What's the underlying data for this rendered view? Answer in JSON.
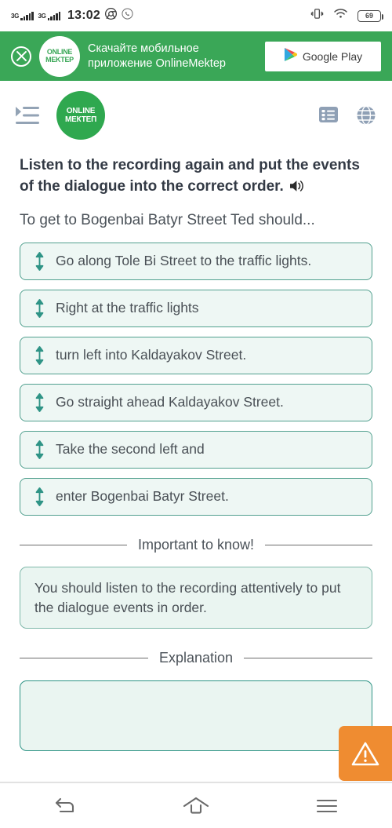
{
  "status_bar": {
    "network_label_1": "3G",
    "network_label_2": "3G",
    "time": "13:02",
    "chrome_icon": "chrome-icon",
    "whatsapp_icon": "whatsapp-icon",
    "vibrate_icon": "vibrate-icon",
    "wifi_icon": "wifi-icon",
    "battery_level": "69"
  },
  "promo_banner": {
    "close_icon": "close-icon",
    "logo_line1": "ONLINE",
    "logo_line2": "MEKTEP",
    "text_line1": "Скачайте мобильное",
    "text_line2": "приложение OnlineMektep",
    "store_button_label": "Google Play",
    "background_color": "#3aa757"
  },
  "app_header": {
    "menu_icon": "menu-indent-icon",
    "logo_line1": "ONLINE",
    "logo_line2": "МЕКТЕП",
    "list_icon": "list-view-icon",
    "globe_icon": "globe-language-icon",
    "logo_color": "#2fa84f"
  },
  "question": {
    "title": "Listen to the recording again and put the events of the dialogue into the correct order.",
    "audio_icon": "speaker-audio-icon",
    "prompt": "To get to Bogenbai Batyr Street Ted should..."
  },
  "order_items": [
    {
      "handle_icon": "drag-vertical-icon",
      "text": "Go along Tole Bi Street to the traffic lights."
    },
    {
      "handle_icon": "drag-vertical-icon",
      "text": "Right at the traffic lights"
    },
    {
      "handle_icon": "drag-vertical-icon",
      "text": "turn left into Kaldayakov Street."
    },
    {
      "handle_icon": "drag-vertical-icon",
      "text": "Go straight ahead Kaldayakov Street."
    },
    {
      "handle_icon": "drag-vertical-icon",
      "text": "Take the second left and"
    },
    {
      "handle_icon": "drag-vertical-icon",
      "text": "enter Bogenbai Batyr Street."
    }
  ],
  "important_section": {
    "divider_label": "Important to know!",
    "body": "You should listen to the recording attentively to put the dialogue events in order."
  },
  "explanation_section": {
    "divider_label": "Explanation",
    "body": ""
  },
  "warning_fab": {
    "icon": "warning-triangle-icon",
    "color": "#ef8c31"
  },
  "bottom_nav": {
    "back_icon": "back-arrow-icon",
    "home_icon": "home-icon",
    "recents_icon": "menu-lines-icon"
  },
  "theme": {
    "accent_green": "#2fa84f",
    "card_border_teal": "#52a08f",
    "card_bg_mint": "#eef7f4",
    "text_dark": "#333a45",
    "text_body": "#4a5056"
  }
}
